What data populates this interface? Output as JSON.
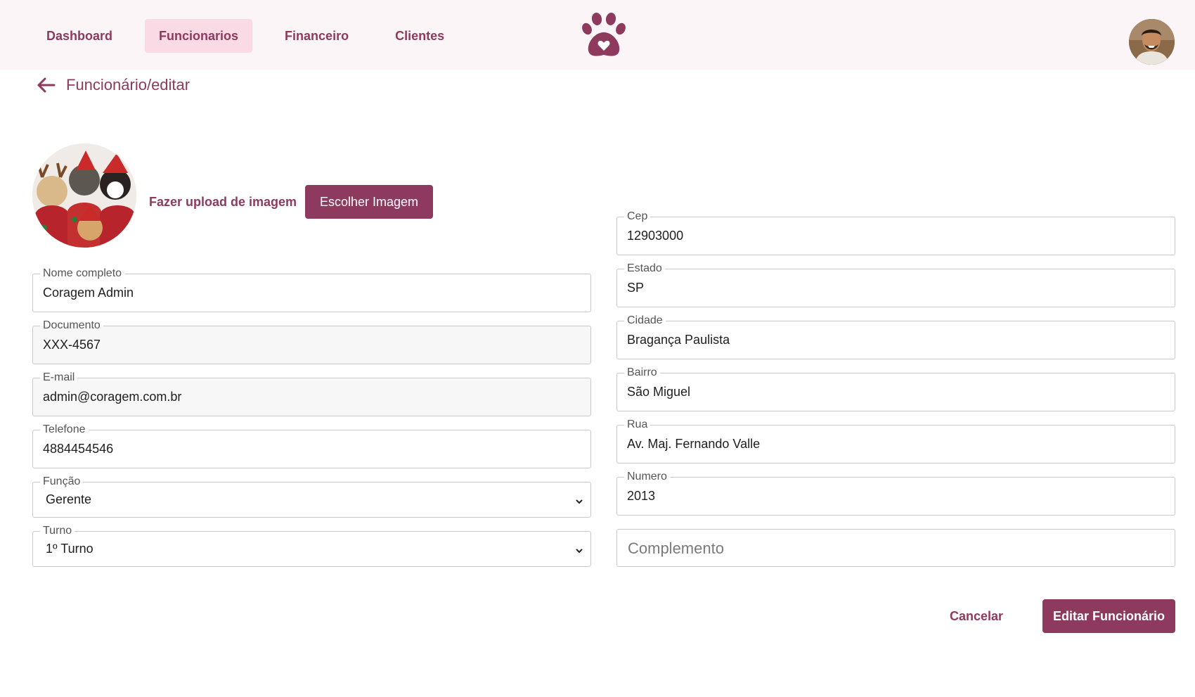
{
  "nav": {
    "items": [
      {
        "label": "Dashboard"
      },
      {
        "label": "Funcionarios"
      },
      {
        "label": "Financeiro"
      },
      {
        "label": "Clientes"
      }
    ],
    "active_index": 1
  },
  "breadcrumb": {
    "title": "Funcionário/editar"
  },
  "upload": {
    "label": "Fazer upload de imagem",
    "button_label": "Escolher Imagem"
  },
  "form": {
    "left": [
      {
        "label": "Nome completo",
        "value": "Coragem Admin"
      },
      {
        "label": "Documento",
        "value": "XXX-4567"
      },
      {
        "label": "E-mail",
        "value": "admin@coragem.com.br"
      },
      {
        "label": "Telefone",
        "value": "4884454546"
      },
      {
        "label": "Função",
        "value": "Gerente"
      },
      {
        "label": "Turno",
        "value": "1º Turno"
      }
    ],
    "right": [
      {
        "label": "Cep",
        "value": "12903000"
      },
      {
        "label": "Estado",
        "value": "SP"
      },
      {
        "label": "Cidade",
        "value": "Bragança Paulista"
      },
      {
        "label": "Bairro",
        "value": "São Miguel"
      },
      {
        "label": "Rua",
        "value": "Av. Maj. Fernando Valle"
      },
      {
        "label": "Numero",
        "value": "2013"
      }
    ],
    "complemento_placeholder": "Complemento"
  },
  "actions": {
    "cancel_label": "Cancelar",
    "submit_label": "Editar Funcionário"
  },
  "colors": {
    "accent": "#8e3a5f",
    "nav_active_bg": "#fadbe5",
    "header_bg": "#fcf5f8"
  },
  "icons": {
    "logo": "paw-heart-icon",
    "back": "arrow-left-icon",
    "select": "chevron-down-icon"
  }
}
